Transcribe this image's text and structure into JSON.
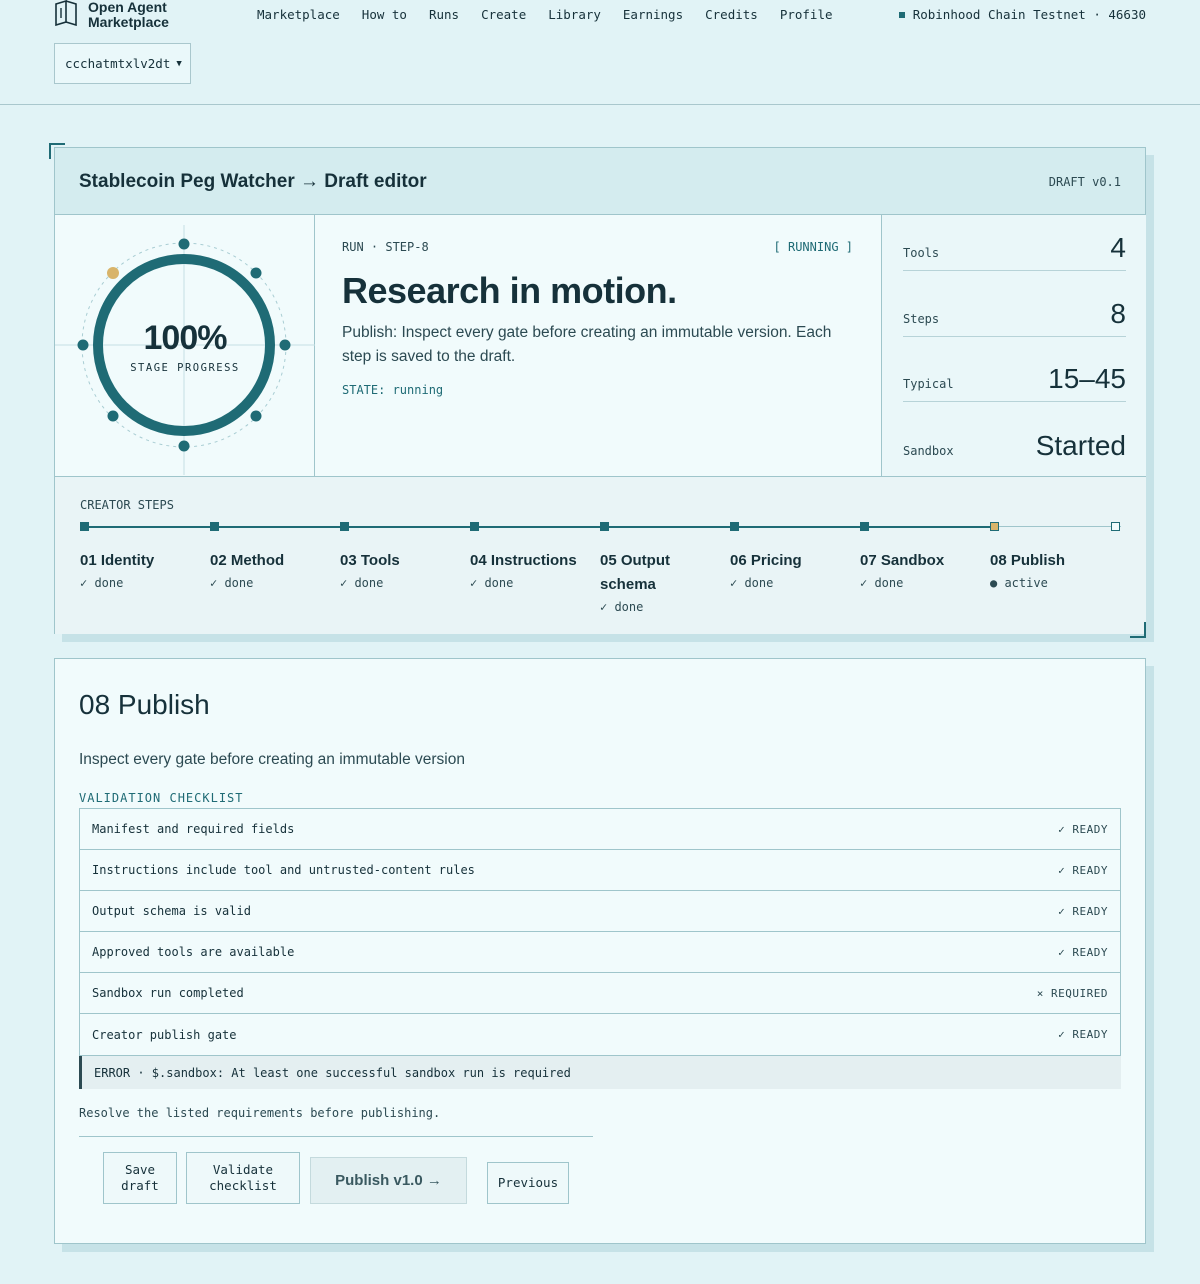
{
  "header": {
    "logo_line1": "Open Agent",
    "logo_line2": "Marketplace",
    "nav": [
      "Marketplace",
      "How to",
      "Runs",
      "Create",
      "Library",
      "Earnings",
      "Credits",
      "Profile"
    ],
    "chain": "Robinhood Chain Testnet · 46630",
    "account": "ccchatmtxlv2dt"
  },
  "editor": {
    "title": "Stablecoin Peg Watcher → Draft editor",
    "version": "DRAFT v0.1",
    "progress_value": "100%",
    "progress_label": "STAGE PROGRESS",
    "run_label": "RUN · STEP-8",
    "status": "[ RUNNING ]",
    "headline": "Research in motion.",
    "description": "Publish: Inspect every gate before creating an immutable version. Each step is saved to the draft.",
    "state": "STATE: running",
    "stats": [
      {
        "label": "Tools",
        "value": "4"
      },
      {
        "label": "Steps",
        "value": "8"
      },
      {
        "label": "Typical",
        "value": "15–45"
      },
      {
        "label": "Sandbox",
        "value": "Started"
      }
    ],
    "steps_label": "CREATOR STEPS",
    "steps": [
      {
        "name": "01 Identity",
        "status": "✓ done"
      },
      {
        "name": "02 Method",
        "status": "✓ done"
      },
      {
        "name": "03 Tools",
        "status": "✓ done"
      },
      {
        "name": "04 Instructions",
        "status": "✓ done"
      },
      {
        "name": "05 Output schema",
        "status": "✓ done"
      },
      {
        "name": "06 Pricing",
        "status": "✓ done"
      },
      {
        "name": "07 Sandbox",
        "status": "✓ done"
      },
      {
        "name": "08 Publish",
        "status": "● active"
      }
    ]
  },
  "publish": {
    "title": "08 Publish",
    "subtitle": "Inspect every gate before creating an immutable version",
    "checklist_label": "VALIDATION CHECKLIST",
    "checklist": [
      {
        "text": "Manifest and required fields",
        "status": "✓ READY"
      },
      {
        "text": "Instructions include tool and untrusted-content rules",
        "status": "✓ READY"
      },
      {
        "text": "Output schema is valid",
        "status": "✓ READY"
      },
      {
        "text": "Approved tools are available",
        "status": "✓ READY"
      },
      {
        "text": "Sandbox run completed",
        "status": "× REQUIRED"
      },
      {
        "text": "Creator publish gate",
        "status": "✓ READY"
      }
    ],
    "error": "ERROR · $.sandbox: At least one successful sandbox run is required",
    "resolve": "Resolve the listed requirements before publishing.",
    "buttons": {
      "save_line1": "Save",
      "save_line2": "draft",
      "validate_line1": "Validate",
      "validate_line2": "checklist",
      "publish": "Publish v1.0 →",
      "previous": "Previous"
    }
  },
  "colors": {
    "accent": "#1f6b75",
    "active_node": "#d8b46a",
    "background": "#e1f3f6"
  }
}
